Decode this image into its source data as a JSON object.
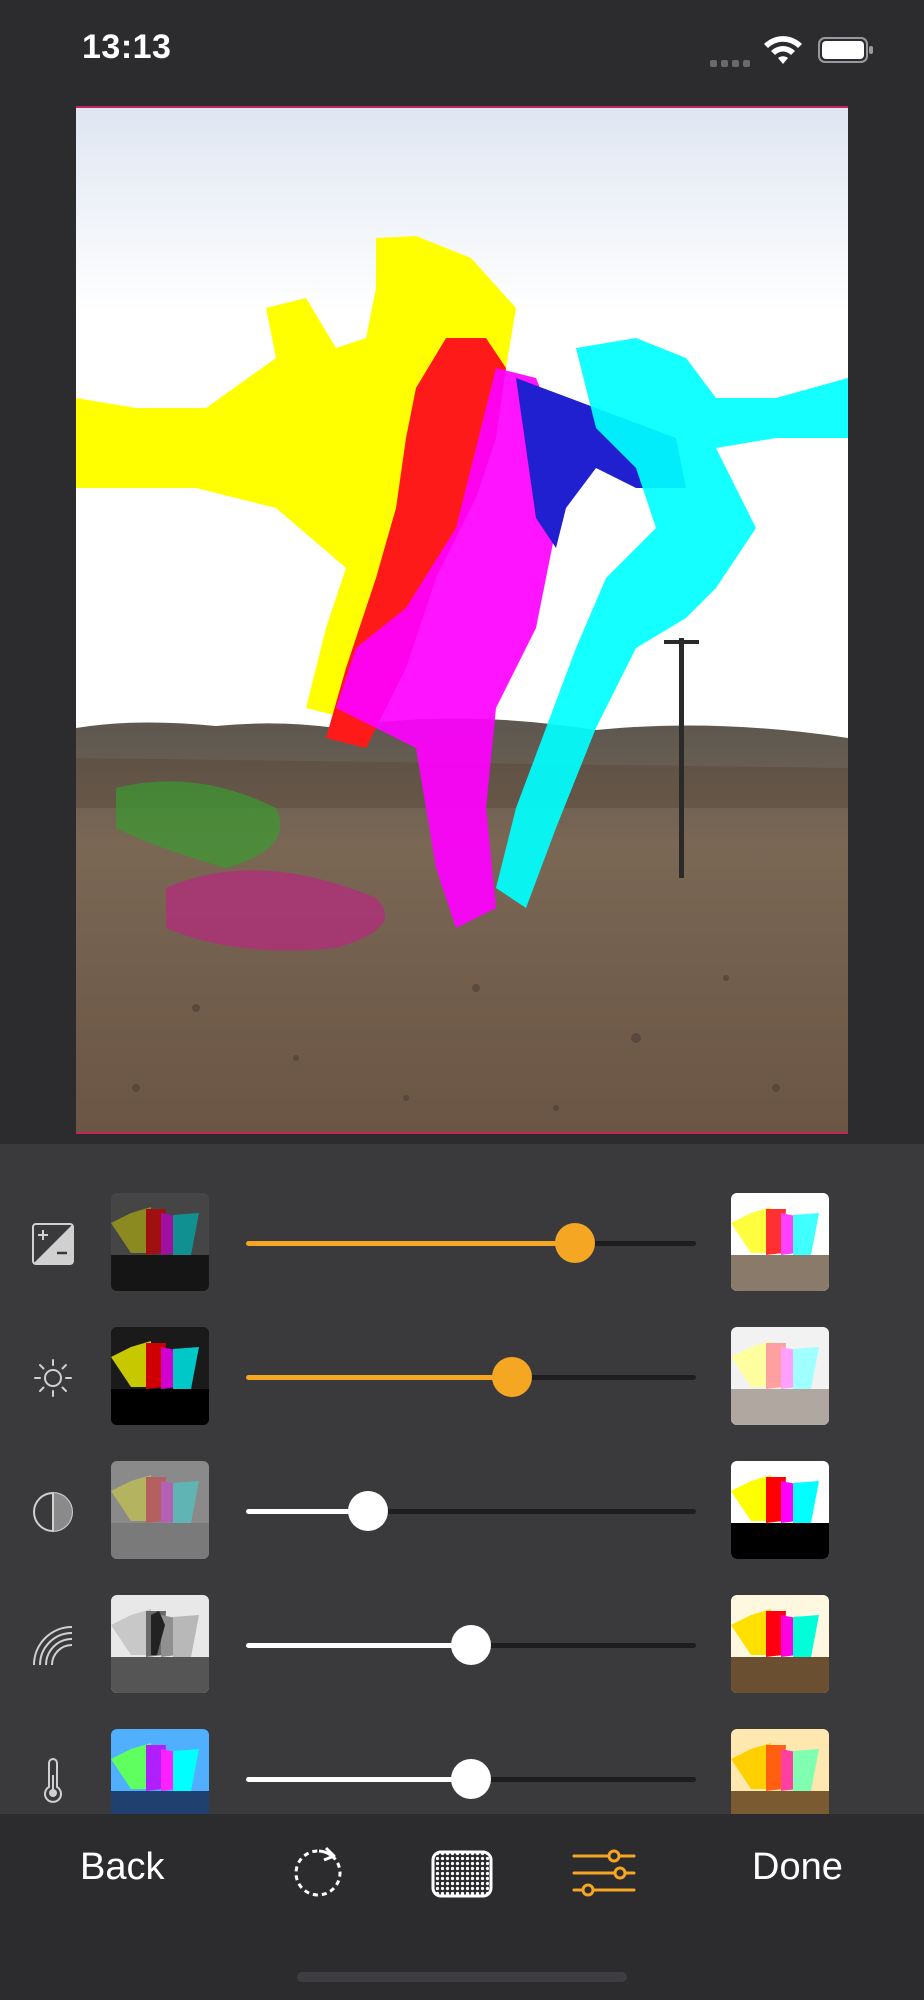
{
  "status_bar": {
    "time": "13:13",
    "icons": [
      "signal-icon",
      "wifi-icon",
      "battery-icon"
    ]
  },
  "photo": {
    "description_icon": "photo-preview"
  },
  "adjustments": [
    {
      "name": "exposure",
      "icon": "exposure-icon",
      "value": 0.73,
      "active": true
    },
    {
      "name": "brightness",
      "icon": "brightness-icon",
      "value": 0.59,
      "active": true
    },
    {
      "name": "contrast",
      "icon": "contrast-icon",
      "value": 0.27,
      "active": false
    },
    {
      "name": "saturation",
      "icon": "saturation-icon",
      "value": 0.5,
      "active": false
    },
    {
      "name": "temperature",
      "icon": "temperature-icon",
      "value": 0.5,
      "active": false
    }
  ],
  "colors": {
    "accent": "#f5a623",
    "inactive": "#ffffff",
    "background": "#2c2c2e",
    "panel": "#3a3a3c"
  },
  "toolbar": {
    "back_label": "Back",
    "done_label": "Done",
    "icons": [
      "reset-icon",
      "texture-icon",
      "adjust-sliders-icon"
    ],
    "selected": "adjust-sliders-icon"
  }
}
